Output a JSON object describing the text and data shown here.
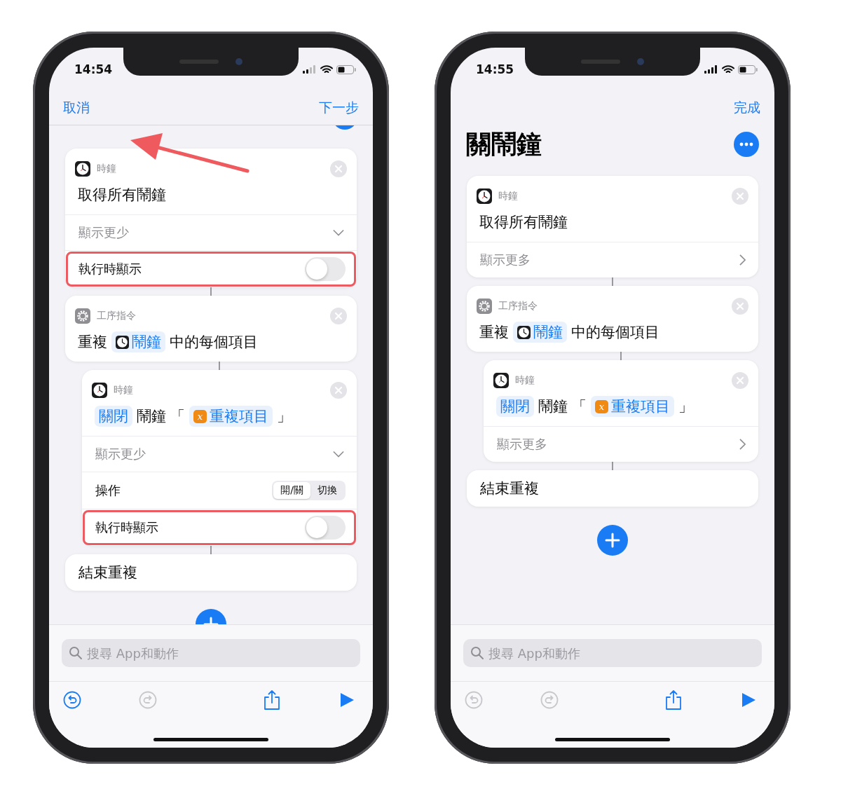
{
  "phones": [
    {
      "time": "14:54",
      "nav": {
        "left": "取消",
        "right": "下一步"
      },
      "scrolled": true,
      "arrow_annotation": true,
      "actions": [
        {
          "kind": "clock",
          "app": "時鐘",
          "title": [
            {
              "kind": "text",
              "text": "取得所有鬧鐘"
            }
          ],
          "expanded": true,
          "more_label": "顯示更少",
          "options": [
            {
              "kind": "toggle",
              "label": "執行時顯示",
              "on": false,
              "highlighted": true
            }
          ]
        },
        {
          "kind": "scripting",
          "app": "工序指令",
          "title": [
            {
              "kind": "text",
              "text": "重複"
            },
            {
              "kind": "clock_variable",
              "text": "鬧鐘"
            },
            {
              "kind": "text",
              "text": "中的每個項目"
            }
          ],
          "end_label": "結束重複",
          "children": [
            {
              "kind": "clock",
              "app": "時鐘",
              "title": [
                {
                  "kind": "param",
                  "text": "關閉"
                },
                {
                  "kind": "text",
                  "text": "鬧鐘"
                },
                {
                  "kind": "text",
                  "text": "「"
                },
                {
                  "kind": "magic_variable",
                  "badge": "x",
                  "text": "重複項目"
                },
                {
                  "kind": "text",
                  "text": "」"
                }
              ],
              "expanded": true,
              "more_label": "顯示更少",
              "options": [
                {
                  "kind": "segmented",
                  "label": "操作",
                  "segments": [
                    {
                      "label": "開/關",
                      "selected": true
                    },
                    {
                      "label": "切換",
                      "selected": false
                    }
                  ]
                },
                {
                  "kind": "toggle",
                  "label": "執行時顯示",
                  "on": false,
                  "highlighted": true
                }
              ]
            }
          ]
        }
      ],
      "search": {
        "placeholder": "搜尋 App和動作"
      },
      "undo_enabled": true,
      "redo_enabled": false
    },
    {
      "time": "14:55",
      "nav": {
        "right": "完成"
      },
      "title": "關鬧鐘",
      "actions": [
        {
          "kind": "clock",
          "app": "時鐘",
          "title": [
            {
              "kind": "text",
              "text": "取得所有鬧鐘"
            }
          ],
          "expanded": false,
          "more_label": "顯示更多"
        },
        {
          "kind": "scripting",
          "app": "工序指令",
          "title": [
            {
              "kind": "text",
              "text": "重複"
            },
            {
              "kind": "clock_variable",
              "text": "鬧鐘"
            },
            {
              "kind": "text",
              "text": "中的每個項目"
            }
          ],
          "end_label": "結束重複",
          "children": [
            {
              "kind": "clock",
              "app": "時鐘",
              "title": [
                {
                  "kind": "param",
                  "text": "關閉"
                },
                {
                  "kind": "text",
                  "text": "鬧鐘"
                },
                {
                  "kind": "text",
                  "text": "「"
                },
                {
                  "kind": "magic_variable",
                  "badge": "x",
                  "text": "重複項目"
                },
                {
                  "kind": "text",
                  "text": "」"
                }
              ],
              "expanded": false,
              "more_label": "顯示更多"
            }
          ]
        }
      ],
      "search": {
        "placeholder": "搜尋 App和動作"
      },
      "undo_enabled": false,
      "redo_enabled": false
    }
  ]
}
